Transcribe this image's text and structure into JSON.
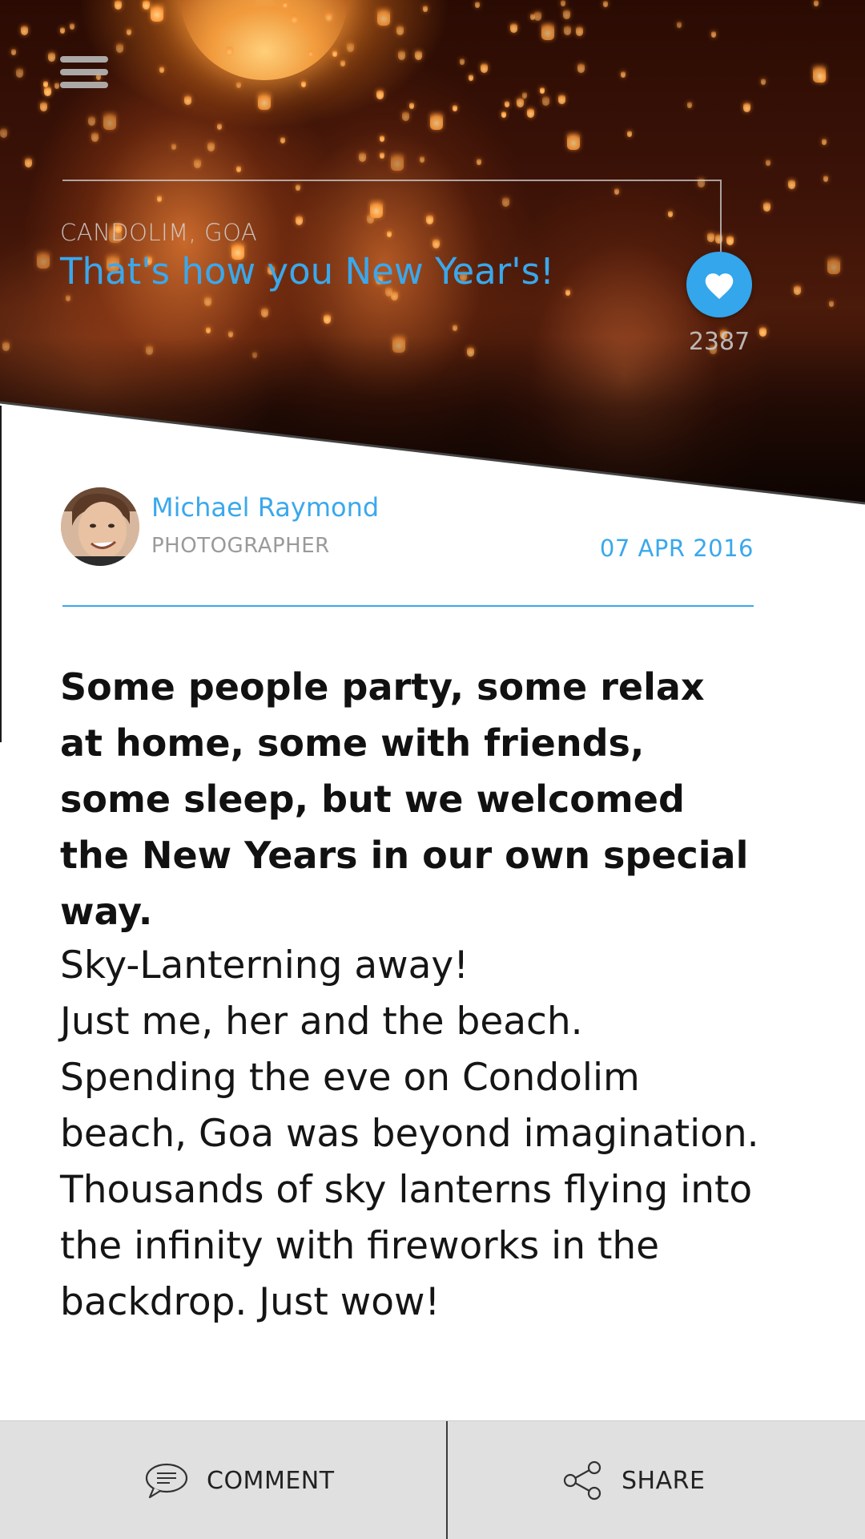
{
  "header": {
    "menu_icon": "hamburger-menu-icon",
    "location": "CANDOLIM, GOA",
    "title": "That's how you New Year's!",
    "like_icon": "heart-icon",
    "like_count": "2387"
  },
  "author": {
    "name": "Michael Raymond",
    "role": "PHOTOGRAPHER",
    "date": "07 APR 2016"
  },
  "content": {
    "lead": "Some people party, some relax at home, some with friends, some sleep, but we welcomed the New Years in our own special way.",
    "body": "Sky-Lanterning away!\nJust me, her and the beach. Spending the eve on Condolim beach, Goa was beyond imagination. Thousands of sky lanterns flying into the infinity with fireworks in the backdrop. Just wow!"
  },
  "actions": {
    "comment_label": "COMMENT",
    "comment_icon": "comment-bubble-icon",
    "share_label": "SHARE",
    "share_icon": "share-icon"
  },
  "colors": {
    "accent": "#33a6ec",
    "bar_background": "#e0e0e0"
  }
}
